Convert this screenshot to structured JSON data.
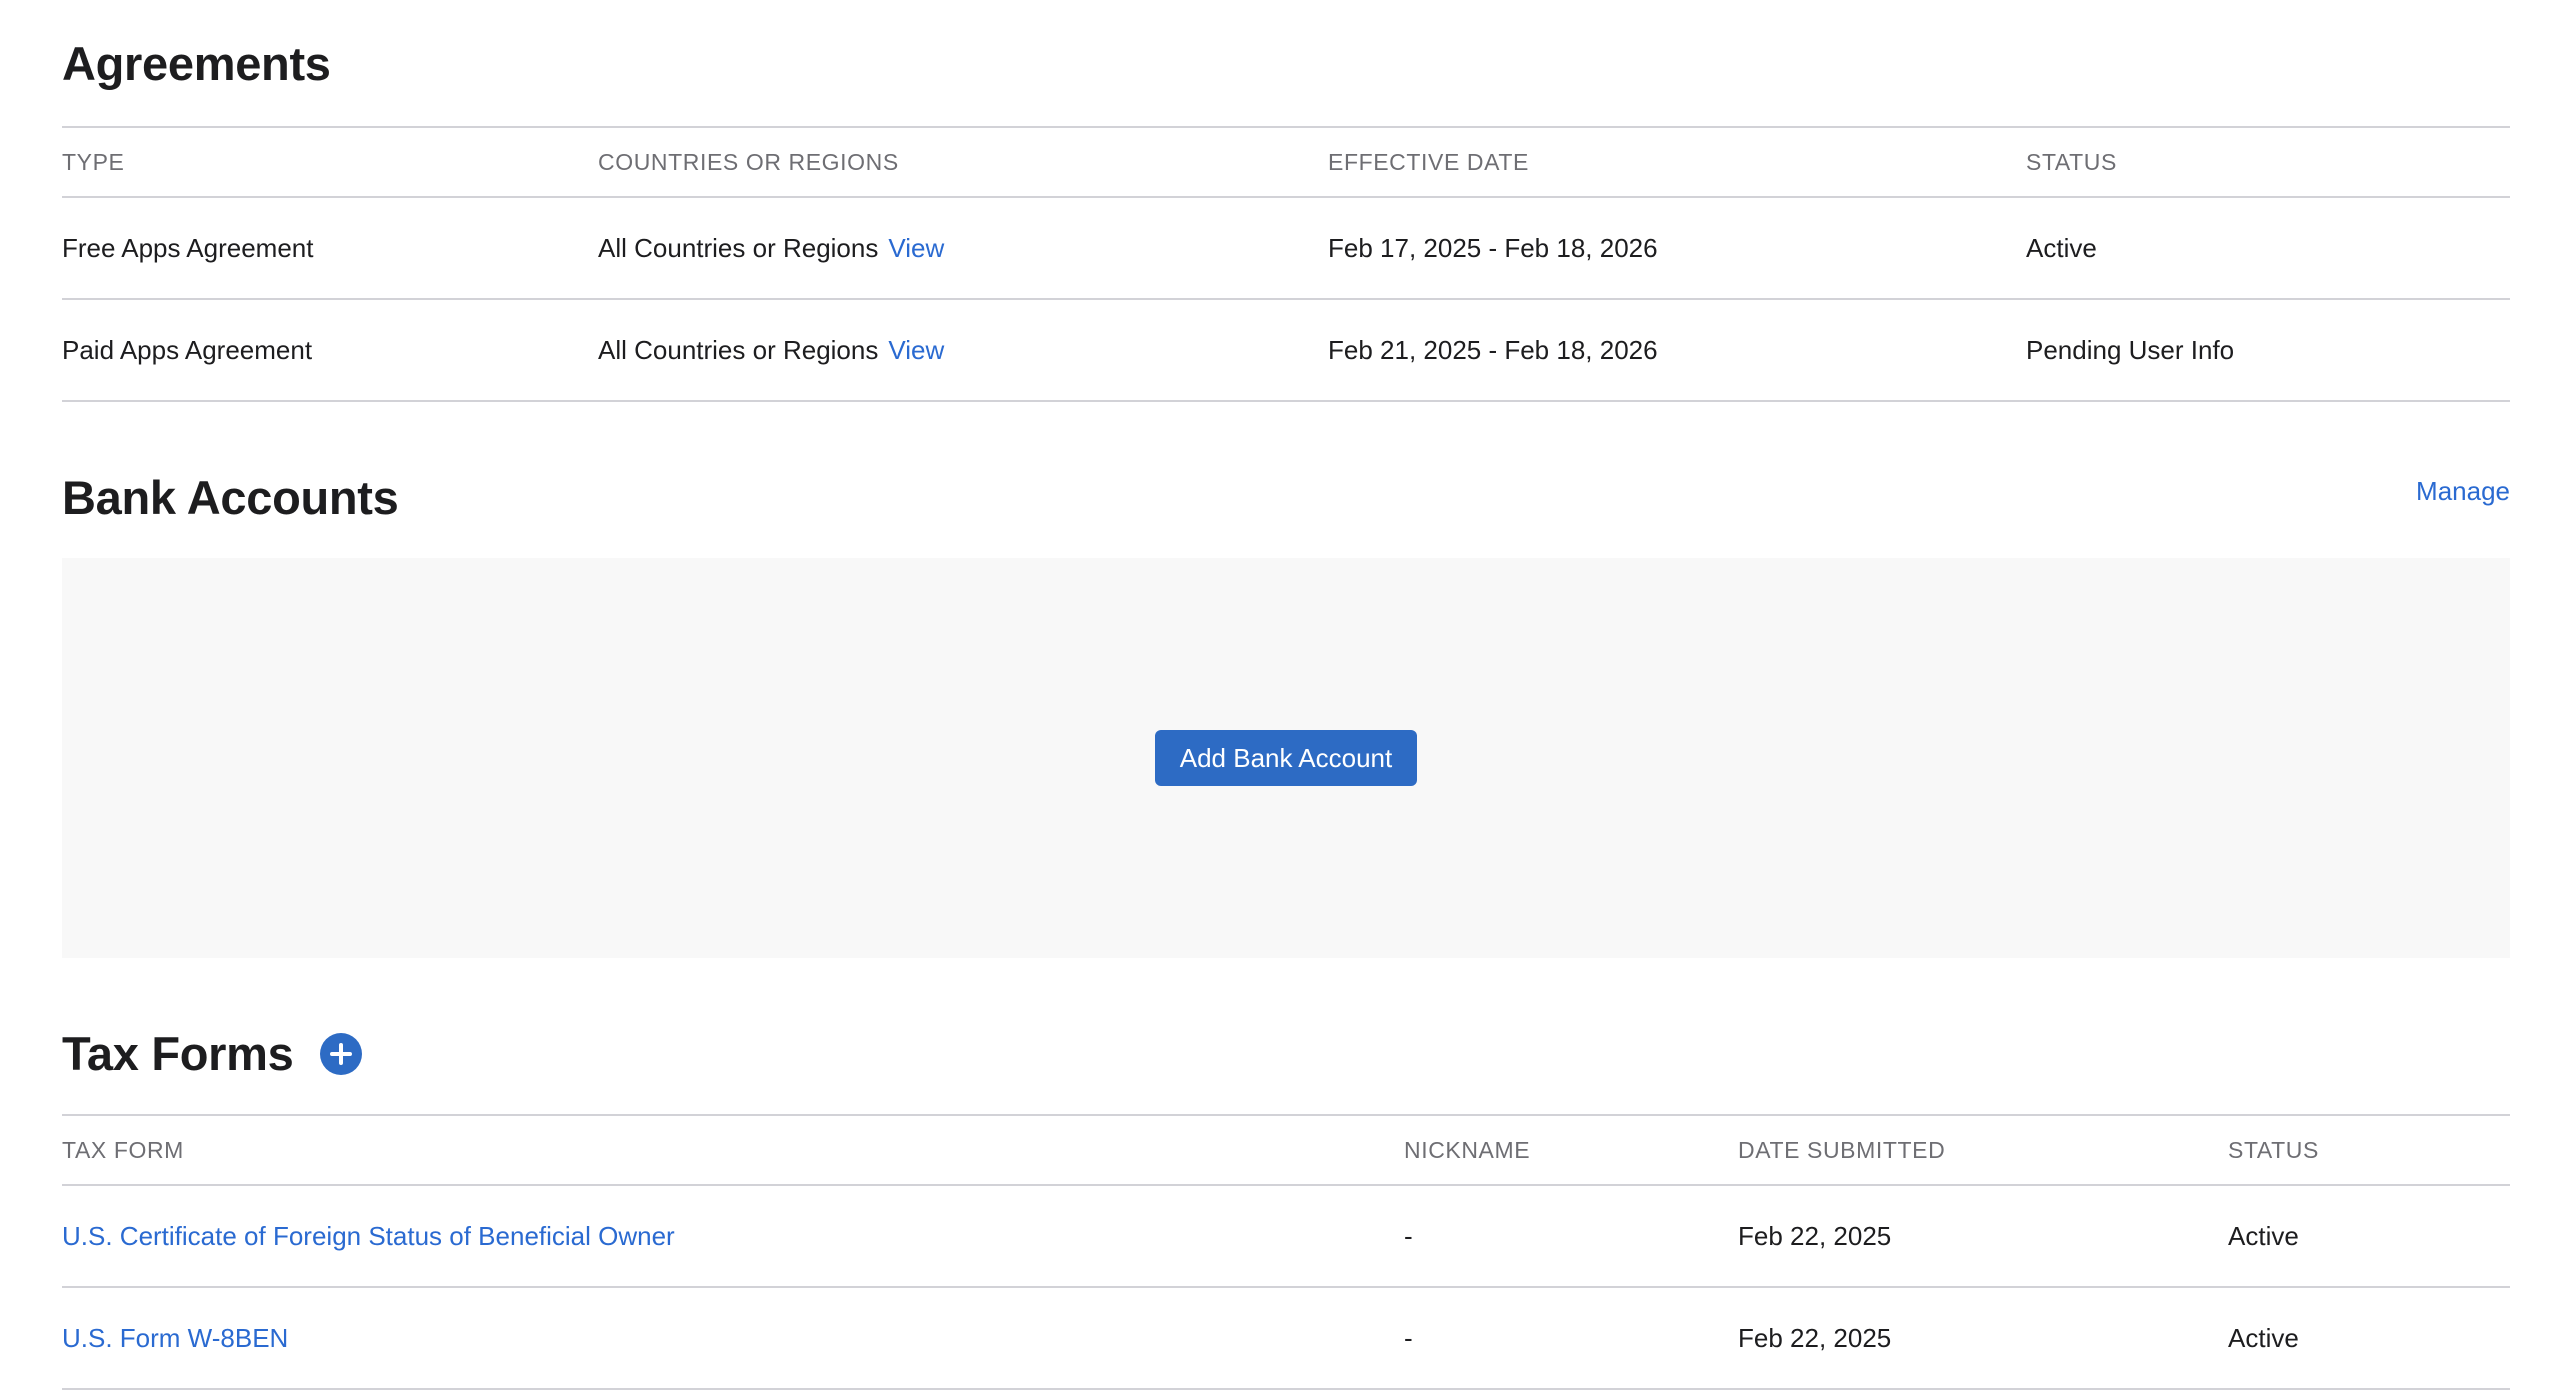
{
  "agreements": {
    "title": "Agreements",
    "columns": [
      "TYPE",
      "COUNTRIES OR REGIONS",
      "EFFECTIVE DATE",
      "STATUS"
    ],
    "rows": [
      {
        "type": "Free Apps Agreement",
        "countries": "All Countries or Regions",
        "countries_link": "View",
        "effective_date": "Feb 17, 2025 - Feb 18, 2026",
        "status": "Active"
      },
      {
        "type": "Paid Apps Agreement",
        "countries": "All Countries or Regions",
        "countries_link": "View",
        "effective_date": "Feb 21, 2025 - Feb 18, 2026",
        "status": "Pending User Info"
      }
    ]
  },
  "bank_accounts": {
    "title": "Bank Accounts",
    "manage_label": "Manage",
    "add_button_label": "Add Bank Account"
  },
  "tax_forms": {
    "title": "Tax Forms",
    "add_icon": "plus-circle-icon",
    "columns": [
      "TAX FORM",
      "NICKNAME",
      "DATE SUBMITTED",
      "STATUS"
    ],
    "rows": [
      {
        "form": "U.S. Certificate of Foreign Status of Beneficial Owner",
        "nickname": "-",
        "date_submitted": "Feb 22, 2025",
        "status": "Active"
      },
      {
        "form": "U.S. Form W-8BEN",
        "nickname": "-",
        "date_submitted": "Feb 22, 2025",
        "status": "Active"
      }
    ]
  },
  "colors": {
    "link": "#2a6ad1",
    "button": "#2d6bc4",
    "divider": "#d2d2d7",
    "header_text": "#6e6e73",
    "panel_bg": "#f8f8f8"
  }
}
